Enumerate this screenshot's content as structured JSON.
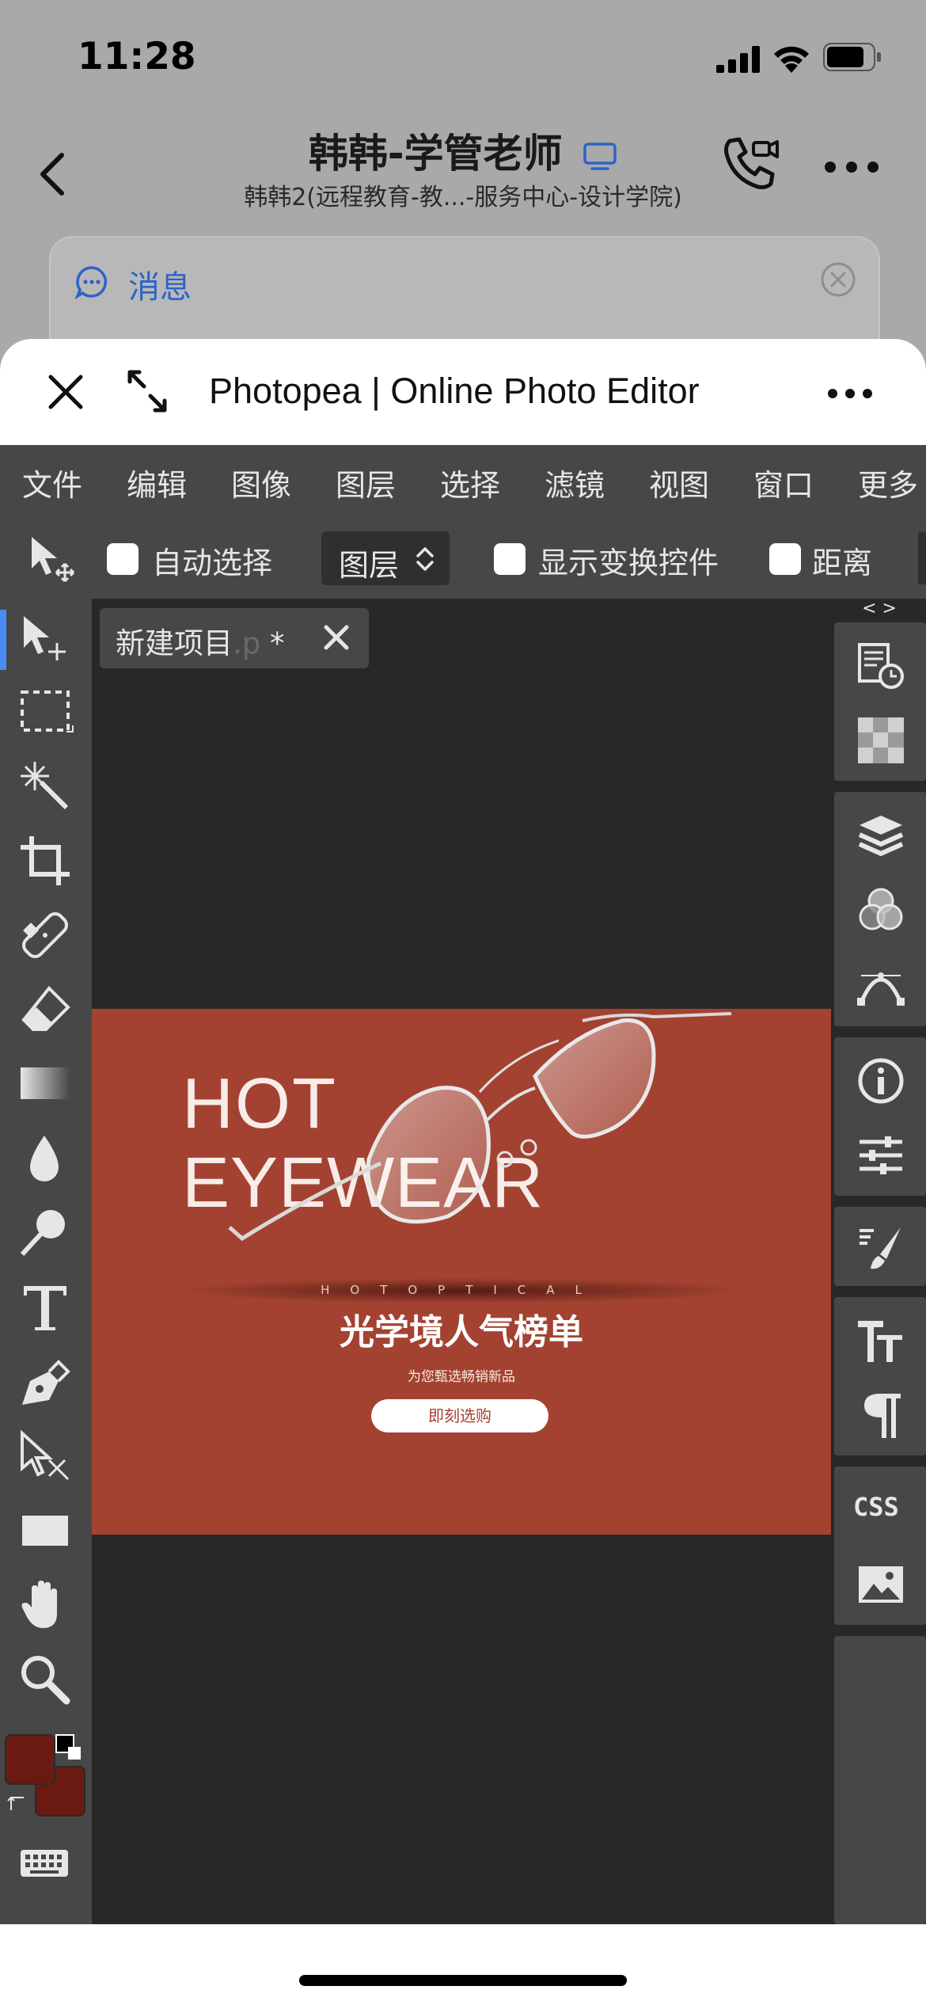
{
  "status_bar": {
    "time": "11:28"
  },
  "chat": {
    "title": "韩韩-学管老师",
    "subtitle": "韩韩2(远程教育-教...-服务中心-设计学院)",
    "card_label": "消息"
  },
  "sheet": {
    "title": "Photopea | Online Photo Editor"
  },
  "menu": [
    "文件",
    "编辑",
    "图像",
    "图层",
    "选择",
    "滤镜",
    "视图",
    "窗口",
    "更多"
  ],
  "options": {
    "auto_select": "自动选择",
    "layer_select": "图层",
    "show_transform": "显示变换控件",
    "distance": "距离"
  },
  "document_tab": {
    "name": "新建项目",
    "ext": ".p",
    "modified": "*"
  },
  "artwork": {
    "line1": "HOT",
    "line2": "EYEWEAR",
    "optical": "HOTOPTICAL",
    "headline": "光学境人气榜单",
    "subline": "为您甄选畅销新品",
    "button": "即刻选购"
  },
  "right_panel": {
    "css_label": "CSS",
    "arrows": "< >"
  },
  "colors": {
    "foreground": "#6b1a12",
    "background": "#6b1a12",
    "artboard": "#a34231",
    "accent": "#4a8af4"
  }
}
